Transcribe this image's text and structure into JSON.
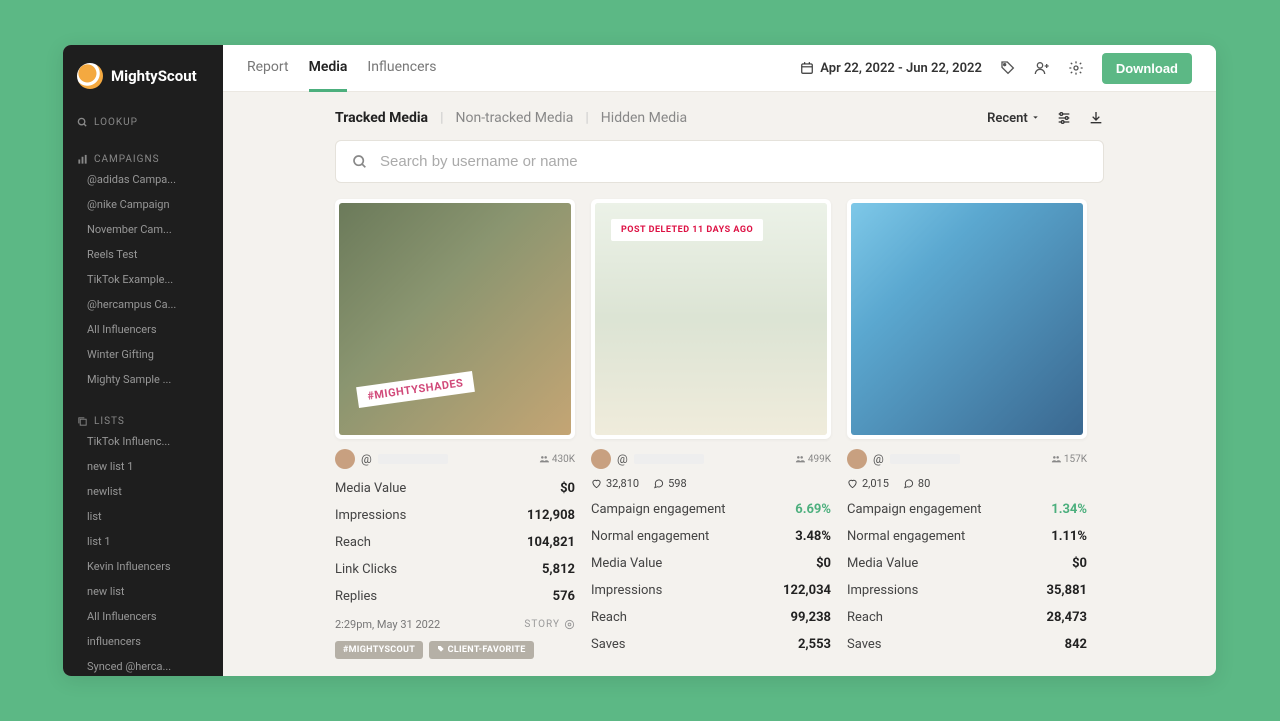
{
  "brand": "MightyScout",
  "sidebar": {
    "lookup": "LOOKUP",
    "campaigns_header": "CAMPAIGNS",
    "campaigns": [
      "@adidas Campa...",
      "@nike Campaign",
      "November Cam...",
      "Reels Test",
      "TikTok Example...",
      "@hercampus Ca...",
      "All Influencers",
      "Winter Gifting",
      "Mighty Sample ..."
    ],
    "lists_header": "LISTS",
    "lists": [
      "TikTok Influenc...",
      "new list 1",
      "newlist",
      "list",
      "list 1",
      "Kevin Influencers",
      "new list",
      "All Influencers",
      "influencers",
      "Synced @herca..."
    ]
  },
  "topnav": {
    "report": "Report",
    "media": "Media",
    "influencers": "Influencers"
  },
  "date_range": "Apr 22, 2022 - Jun 22, 2022",
  "download": "Download",
  "filter_tabs": {
    "tracked": "Tracked Media",
    "nontracked": "Non-tracked Media",
    "hidden": "Hidden Media"
  },
  "sort": "Recent",
  "search_placeholder": "Search by username or name",
  "cards": [
    {
      "followers": "430K",
      "stats": [
        {
          "label": "Media Value",
          "value": "$0"
        },
        {
          "label": "Impressions",
          "value": "112,908"
        },
        {
          "label": "Reach",
          "value": "104,821"
        },
        {
          "label": "Link Clicks",
          "value": "5,812"
        },
        {
          "label": "Replies",
          "value": "576"
        }
      ],
      "timestamp": "2:29pm, May 31 2022",
      "type": "STORY",
      "tags": [
        "#MIGHTYSCOUT",
        "CLIENT-FAVORITE"
      ]
    },
    {
      "deleted": "POST DELETED 11 DAYS AGO",
      "followers": "499K",
      "likes": "32,810",
      "comments": "598",
      "stats": [
        {
          "label": "Campaign engagement",
          "value": "6.69%",
          "green": true
        },
        {
          "label": "Normal engagement",
          "value": "3.48%"
        },
        {
          "label": "Media Value",
          "value": "$0"
        },
        {
          "label": "Impressions",
          "value": "122,034"
        },
        {
          "label": "Reach",
          "value": "99,238"
        },
        {
          "label": "Saves",
          "value": "2,553"
        }
      ]
    },
    {
      "followers": "157K",
      "likes": "2,015",
      "comments": "80",
      "stats": [
        {
          "label": "Campaign engagement",
          "value": "1.34%",
          "green": true
        },
        {
          "label": "Normal engagement",
          "value": "1.11%"
        },
        {
          "label": "Media Value",
          "value": "$0"
        },
        {
          "label": "Impressions",
          "value": "35,881"
        },
        {
          "label": "Reach",
          "value": "28,473"
        },
        {
          "label": "Saves",
          "value": "842"
        }
      ]
    }
  ]
}
